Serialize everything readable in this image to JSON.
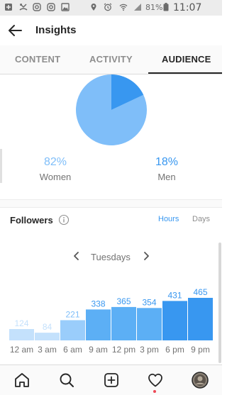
{
  "status_bar": {
    "battery": "81%",
    "time": "11:07 a.m.",
    "icons": [
      "add-box-icon",
      "missed-call-icon",
      "instagram-icon",
      "instagram-icon",
      "image-icon",
      "location-icon",
      "alarm-icon",
      "wifi-icon",
      "signal-icon",
      "battery-icon"
    ]
  },
  "header": {
    "title": "Insights",
    "back_icon": "arrow-left-icon"
  },
  "tabs": [
    {
      "label": "CONTENT",
      "active": false
    },
    {
      "label": "ACTIVITY",
      "active": false
    },
    {
      "label": "AUDIENCE",
      "active": true
    }
  ],
  "gender": {
    "women": {
      "percent": "82%",
      "label": "Women",
      "value": 82,
      "color": "#7fbef9"
    },
    "men": {
      "percent": "18%",
      "label": "Men",
      "value": 18,
      "color": "#3897f0"
    }
  },
  "followers": {
    "title": "Followers",
    "info_icon": "info-icon",
    "toggle": {
      "hours": "Hours",
      "days": "Days",
      "selected": "Hours"
    },
    "day": "Tuesdays"
  },
  "chart_data": {
    "type": "bar",
    "categories": [
      "12 am",
      "3 am",
      "6 am",
      "9 am",
      "12 pm",
      "3 pm",
      "6 pm",
      "9 pm"
    ],
    "values": [
      124,
      84,
      221,
      338,
      365,
      354,
      431,
      465
    ],
    "colors": [
      "#c4e1fc",
      "#c4e1fc",
      "#9acdfb",
      "#5caff5",
      "#5caff5",
      "#5caff5",
      "#3897f0",
      "#3897f0"
    ],
    "label_colors": [
      "#c4e1fc",
      "#c4e1fc",
      "#7fbef9",
      "#3897f0",
      "#3897f0",
      "#3897f0",
      "#3897f0",
      "#3897f0"
    ],
    "title": "",
    "xlabel": "",
    "ylabel": "",
    "ylim": [
      0,
      465
    ],
    "grid": false,
    "legend": "none"
  },
  "bottom_nav": [
    "home-icon",
    "search-icon",
    "add-post-icon",
    "activity-heart-icon",
    "profile-avatar-icon"
  ]
}
